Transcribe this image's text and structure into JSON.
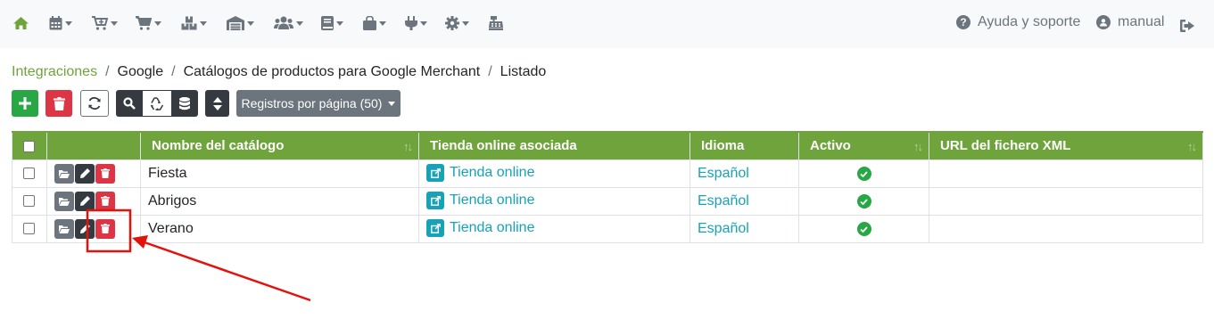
{
  "nav": {
    "help_label": "Ayuda y soporte",
    "user_label": "manual",
    "icons": [
      "home-icon",
      "calendar-icon",
      "cart-plus-icon",
      "cart-icon",
      "boxes-icon",
      "warehouse-icon",
      "users-icon",
      "book-icon",
      "shopping-bag-icon",
      "plug-icon",
      "gear-icon",
      "cash-register-icon",
      "question-circle-icon",
      "user-circle-icon",
      "sign-out-icon"
    ]
  },
  "breadcrumb": {
    "items": [
      "Integraciones",
      "Google",
      "Catálogos de productos para Google Merchant",
      "Listado"
    ]
  },
  "toolbar": {
    "records_label": "Registros por página (50)"
  },
  "table": {
    "headers": [
      "Nombre del catálogo",
      "Tienda online asociada",
      "Idioma",
      "Activo",
      "URL del fichero XML"
    ],
    "rows": [
      {
        "name": "Fiesta",
        "store": "Tienda online",
        "language": "Español",
        "active": true,
        "xml_url": ""
      },
      {
        "name": "Abrigos",
        "store": "Tienda online",
        "language": "Español",
        "active": true,
        "xml_url": ""
      },
      {
        "name": "Verano",
        "store": "Tienda online",
        "language": "Español",
        "active": true,
        "xml_url": ""
      }
    ]
  },
  "colors": {
    "accent": "#6fa33b",
    "success": "#28a745",
    "danger": "#dc3545",
    "info": "#17a2b8",
    "dark": "#343a40",
    "secondary": "#6c757d",
    "annotation": "#e3120b"
  }
}
